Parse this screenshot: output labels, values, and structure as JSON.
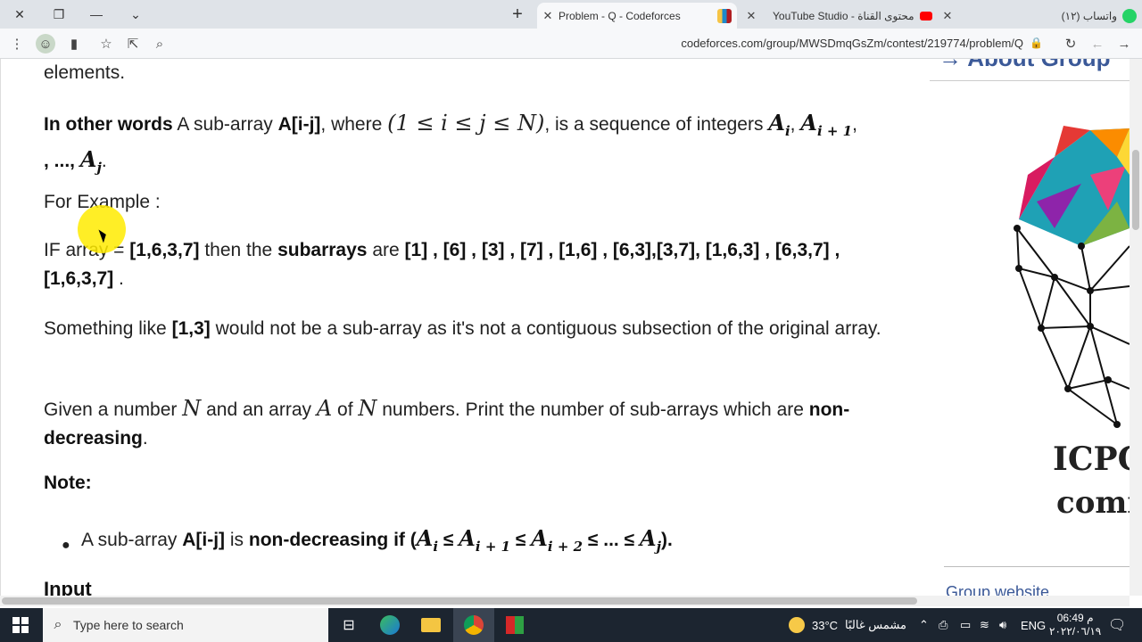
{
  "browser": {
    "tabs": [
      {
        "title": "Problem - Q - Codeforces",
        "favicon": "codeforces-favicon",
        "active": true
      },
      {
        "title": "YouTube Studio - محتوى القناة",
        "favicon": "youtube-studio-favicon",
        "active": false
      },
      {
        "title": "واتساب (١٢)",
        "favicon": "whatsapp-favicon",
        "active": false
      }
    ],
    "url": "codeforces.com/group/MWSDmqGsZm/contest/219774/problem/Q"
  },
  "content": {
    "p0": "elements.",
    "p1": {
      "b1": "In other words",
      "t1": " A sub-array ",
      "b2": "A[i-j]",
      "t2": ", where ",
      "math1": "(1 ≤ i ≤ j ≤ N)",
      "t3": ", is a sequence of integers ",
      "m_a": "A",
      "m_i": "i",
      "m_a2": "A",
      "m_i1": "i + 1",
      "t4": ", ..., ",
      "m_a3": "A",
      "m_j": "j",
      "t5": "."
    },
    "p2": "For Example :",
    "p3": {
      "t1": "IF array = ",
      "b1": "[1,6,3,7]",
      "t2": " then the ",
      "b2": "subarrays",
      "t3": " are ",
      "b3": "[1] , [6] , [3] , [7] , [1,6] , [6,3],[3,7], [1,6,3] , [6,3,7] , [1,6,3,7]",
      "t4": " ."
    },
    "p4": {
      "t1": "Something like ",
      "b1": "[1,3]",
      "t2": " would not be a sub-array as it's not a contiguous subsection of the original array."
    },
    "p5": {
      "t1": "Given a number ",
      "m1": "N",
      "t2": " and an array ",
      "m2": "A",
      "t3": " of ",
      "m3": "N",
      "t4": " numbers. Print the number of sub-arrays which are ",
      "b1": "non-decreasing",
      "t5": "."
    },
    "note_heading": "Note:",
    "bullet": {
      "t1": "A sub-array ",
      "b1": "A[i-j]",
      "t2": " is ",
      "b2": "non-decreasing",
      "t3": " if (",
      "ma": "A",
      "s1": "i",
      "s2": "i + 1",
      "s3": "i + 2",
      "s4": "j",
      "leq": " ≤ ",
      "dots": "...",
      "t4": ")."
    },
    "input_heading": "Input"
  },
  "sidebar": {
    "about_title": "→ About Group",
    "logo_text1": "ICPC",
    "logo_text2": "comm",
    "group_website": "Group website"
  },
  "taskbar": {
    "search_placeholder": "Type here to search",
    "weather_temp": "33°C",
    "weather_text": "مشمس غالبًا",
    "lang": "ENG",
    "time": "06:49 م",
    "date": "٢٠٢٢/٠٦/١٩"
  }
}
